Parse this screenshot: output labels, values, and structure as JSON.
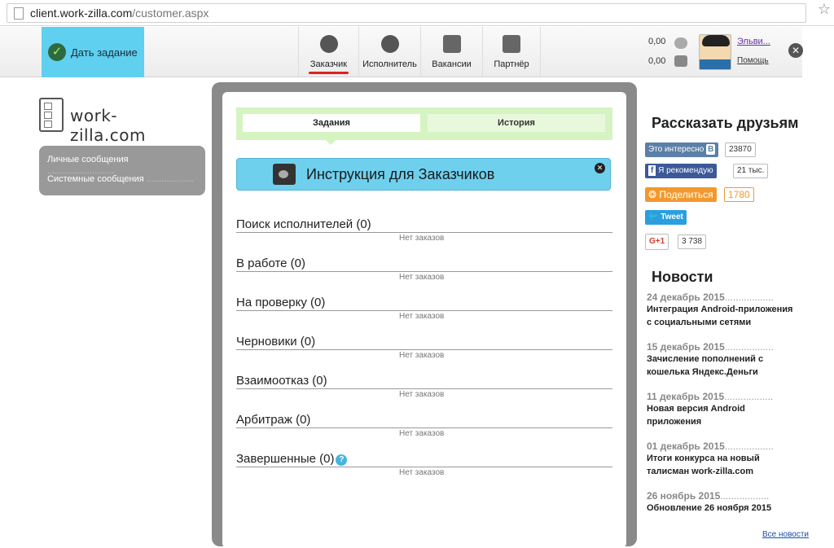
{
  "browser": {
    "url_host": "client.work-zilla.com",
    "url_path": "/customer.aspx",
    "bookmark_icon": "star-icon"
  },
  "topnav": {
    "give_task_label": "Дать задание",
    "tabs": [
      {
        "label": "Заказчик",
        "icon": "customer-icon",
        "active": true
      },
      {
        "label": "Исполнитель",
        "icon": "performer-icon",
        "active": false
      },
      {
        "label": "Вакансии",
        "icon": "vacancies-icon",
        "active": false
      },
      {
        "label": "Партнёр",
        "icon": "partner-icon",
        "active": false
      }
    ],
    "balance_top": "0,00",
    "balance_bottom": "0,00",
    "user_name": "Эльви...",
    "help_label": "Помощь",
    "accent_color": "#5fd0f0",
    "active_underline_color": "#e0211d"
  },
  "sidebar": {
    "logo_text": "work-zilla.com",
    "messages": [
      {
        "label": "Личные сообщения",
        "dots": "..........................."
      },
      {
        "label": "Системные сообщения",
        "dots": "..................."
      }
    ]
  },
  "main": {
    "tabs": [
      {
        "label": "Задания",
        "active": true
      },
      {
        "label": "История",
        "active": false
      }
    ],
    "instruction_title": "Инструкция для Заказчиков",
    "sections": [
      {
        "title": "Поиск исполнителей (0)",
        "empty": "Нет заказов"
      },
      {
        "title": "В работе (0)",
        "empty": "Нет заказов"
      },
      {
        "title": "На проверку (0)",
        "empty": "Нет заказов"
      },
      {
        "title": "Черновики (0)",
        "empty": "Нет заказов"
      },
      {
        "title": "Взаимоотказ (0)",
        "empty": "Нет заказов"
      },
      {
        "title": "Арбитраж (0)",
        "empty": "Нет заказов"
      },
      {
        "title": "Завершенные (0)",
        "empty": "Нет заказов",
        "help_mark": "?"
      }
    ]
  },
  "right": {
    "share_title": "Рассказать друзьям",
    "share": {
      "vk_label": "Это интересно",
      "vk_count": "23870",
      "fb_label": "Я рекомендую",
      "fb_count": "21 тыс.",
      "ok_label": "Поделиться",
      "ok_count": "1780",
      "tw_label": "Tweet",
      "gplus_label": "G+1",
      "gplus_count": "3 738"
    },
    "news_title": "Новости",
    "news": [
      {
        "date": "24 декабрь 2015",
        "dots": "..................",
        "lines": [
          "Интеграция Android-приложения",
          "с социальными сетями"
        ]
      },
      {
        "date": "15 декабрь 2015",
        "dots": "..................",
        "lines": [
          "Зачисление пополнений с",
          "кошелька Яндекс.Деньги"
        ]
      },
      {
        "date": "11 декабрь 2015",
        "dots": "..................",
        "lines": [
          "Новая версия Android",
          "приложения"
        ]
      },
      {
        "date": "01 декабрь 2015",
        "dots": "..................",
        "lines": [
          "Итоги конкурса на новый",
          "талисман work-zilla.com"
        ]
      },
      {
        "date": "26 ноябрь 2015",
        "dots": "..................",
        "lines": [
          "Обновление 26 ноября 2015"
        ]
      }
    ],
    "all_news": "Все новости"
  }
}
